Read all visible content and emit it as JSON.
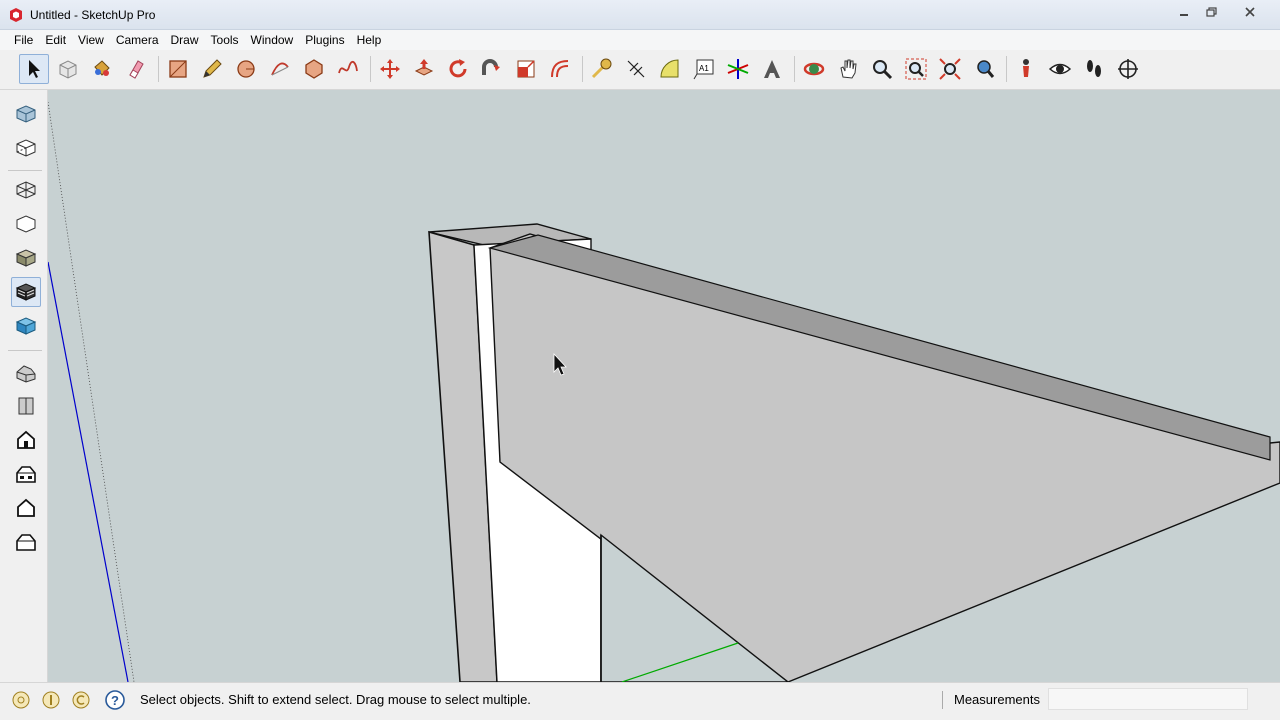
{
  "window": {
    "title": "Untitled - SketchUp Pro"
  },
  "menu": {
    "items": [
      "File",
      "Edit",
      "View",
      "Camera",
      "Draw",
      "Tools",
      "Window",
      "Plugins",
      "Help"
    ]
  },
  "toolbar_top": {
    "tools": [
      "select",
      "make-component",
      "paint-bucket",
      "eraser",
      "rectangle",
      "line",
      "circle",
      "arc",
      "polygon",
      "freehand",
      "move",
      "push-pull",
      "rotate",
      "follow-me",
      "scale",
      "offset",
      "tape-measure",
      "dimension",
      "protractor",
      "text",
      "axes",
      "3d-text",
      "orbit",
      "pan",
      "zoom",
      "zoom-window",
      "zoom-extents",
      "previous-view",
      "position-camera",
      "look-around",
      "walk",
      "section-plane"
    ],
    "active_tool": "select"
  },
  "toolbar_left": {
    "styles": [
      "x-ray",
      "back-edges",
      "wireframe",
      "hidden-line",
      "shaded",
      "shaded-with-textures",
      "monochrome"
    ],
    "active_style": "shaded-with-textures",
    "views": [
      "iso",
      "top",
      "front",
      "right",
      "back",
      "left"
    ]
  },
  "colors": {
    "viewport_bg": "#c7d1d2",
    "face_front": "#c5c5c5",
    "face_top": "#9a9a9a",
    "face_white": "#ffffff",
    "axis_blue": "#0000cc",
    "axis_green": "#00aa00"
  },
  "statusbar": {
    "message": "Select objects. Shift to extend select. Drag mouse to select multiple.",
    "measurements_label": "Measurements",
    "measurements_value": ""
  }
}
